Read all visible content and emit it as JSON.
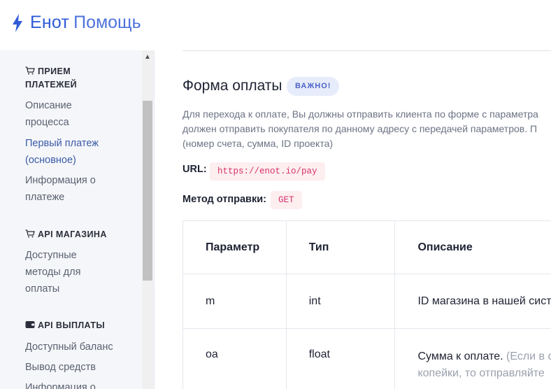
{
  "header": {
    "brand": "Енот",
    "section": "Помощь"
  },
  "sidebar": {
    "sections": [
      {
        "title_line1": "ПРИЕМ",
        "title_line2": "ПЛАТЕЖЕЙ",
        "icon": "cart-icon",
        "items": [
          {
            "label_line1": "Описание",
            "label_line2": "процесса"
          },
          {
            "label_line1": "Первый платеж",
            "label_line2": "(основное)",
            "active": true
          },
          {
            "label_line1": "Информация о",
            "label_line2": "платеже"
          }
        ]
      },
      {
        "title_line1": "API МАГАЗИНА",
        "icon": "cart-icon",
        "items": [
          {
            "label_line1": "Доступные",
            "label_line2": "методы для",
            "label_line3": "оплаты"
          }
        ]
      },
      {
        "title_line1": "API ВЫПЛАТЫ",
        "icon": "wallet-icon",
        "items": [
          {
            "label_line1": "Доступный баланс"
          },
          {
            "label_line1": "Вывод средств"
          },
          {
            "label_line1": "Информация о"
          }
        ]
      }
    ]
  },
  "main": {
    "title": "Форма оплаты",
    "badge": "ВАЖНО!",
    "description": [
      "Для перехода к оплате, Вы должны отправить клиента по форме с параметра",
      "должен отправить покупателя по данному адресу с передачей параметров. П",
      "(номер счета, сумма, ID проекта)"
    ],
    "url_label": "URL:",
    "url_value": "https://enot.io/pay",
    "method_label": "Метод отправки:",
    "method_value": "GET",
    "table": {
      "headers": [
        "Параметр",
        "Тип",
        "Описание"
      ],
      "rows": [
        {
          "param": "m",
          "type": "int",
          "desc_line1": "ID магазина в нашей сист",
          "desc_line1_muted": ""
        },
        {
          "param": "oa",
          "type": "float",
          "desc_line1": "Сумма к оплате.",
          "desc_line1_muted": " (Если в с",
          "desc_line2_muted": "копейки, то отправляйте"
        }
      ]
    }
  }
}
